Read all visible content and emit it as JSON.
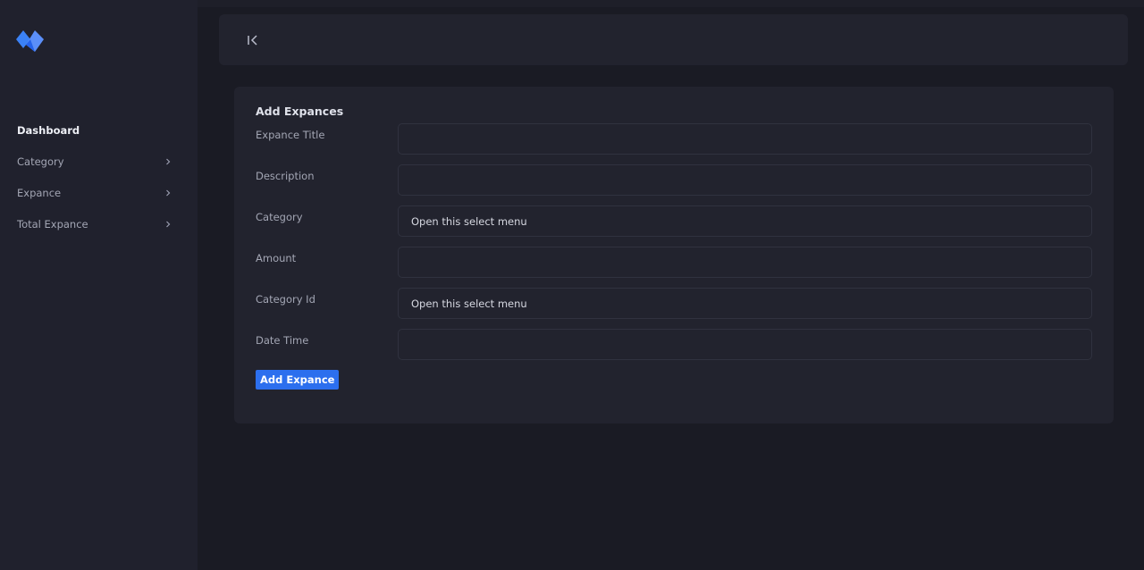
{
  "sidebar": {
    "logo_icon": "brand-logo-icon",
    "items": [
      {
        "label": "Dashboard",
        "active": true
      },
      {
        "label": "Category",
        "icon": "chevron-right-icon"
      },
      {
        "label": "Expance",
        "icon": "chevron-right-icon"
      },
      {
        "label": "Total Expance",
        "icon": "chevron-right-icon"
      }
    ]
  },
  "topbar": {
    "collapse_icon": "collapse-sidebar-icon"
  },
  "form": {
    "title": "Add Expances",
    "fields": [
      {
        "label": "Expance Title",
        "value": ""
      },
      {
        "label": "Description",
        "value": ""
      },
      {
        "label": "Category",
        "value": "Open this select menu"
      },
      {
        "label": "Amount",
        "value": ""
      },
      {
        "label": "Category Id",
        "value": "Open this select menu"
      },
      {
        "label": "Date Time",
        "value": ""
      }
    ],
    "submit_label": "Add Expance"
  },
  "colors": {
    "sidebar_bg": "#20212d",
    "page_bg": "#1a1b24",
    "card_bg": "#22232e",
    "accent": "#2c6fee"
  }
}
